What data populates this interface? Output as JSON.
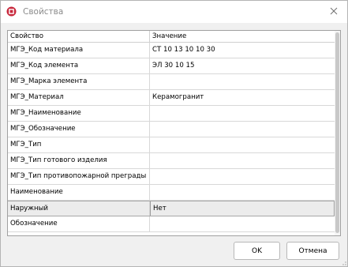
{
  "window": {
    "title": "Свойства",
    "app_icon": "app-logo-icon",
    "close_icon": "close-icon"
  },
  "grid": {
    "columns": [
      "Свойство",
      "Значение"
    ],
    "rows": [
      {
        "property": "МГЭ_Код материала",
        "value": "СТ 10 13 10 10 30"
      },
      {
        "property": "МГЭ_Код элемента",
        "value": "ЭЛ 30 10 15"
      },
      {
        "property": "МГЭ_Марка элемента",
        "value": ""
      },
      {
        "property": "МГЭ_Материал",
        "value": "Керамогранит"
      },
      {
        "property": "МГЭ_Наименование",
        "value": ""
      },
      {
        "property": "МГЭ_Обозначение",
        "value": ""
      },
      {
        "property": "МГЭ_Тип",
        "value": ""
      },
      {
        "property": "МГЭ_Тип готового изделия",
        "value": ""
      },
      {
        "property": "МГЭ_Тип противопожарной преграды",
        "value": ""
      },
      {
        "property": "Наименование",
        "value": ""
      },
      {
        "property": "Наружный",
        "value": "Нет"
      },
      {
        "property": "Обозначение",
        "value": ""
      }
    ],
    "selected_row_index": 10
  },
  "buttons": {
    "ok_label": "OK",
    "cancel_label": "Отмена"
  },
  "colors": {
    "accent_icon": "#c8283c",
    "selected_row": "#ececec",
    "border": "#a0a0a0"
  }
}
